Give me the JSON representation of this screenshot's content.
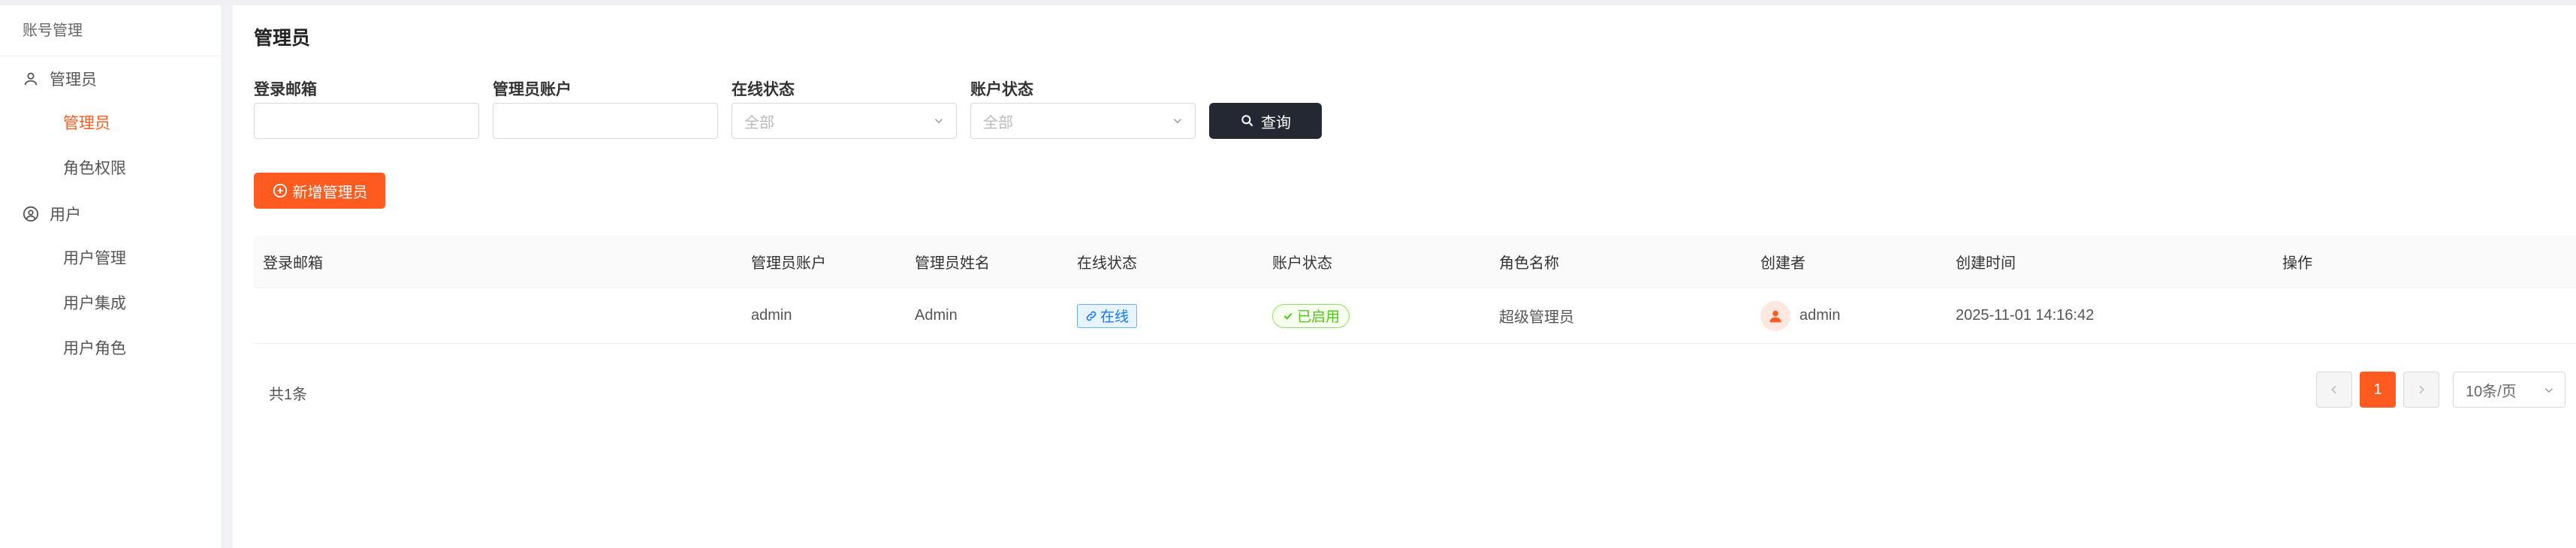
{
  "sidebar": {
    "title": "账号管理",
    "groups": [
      {
        "label": "管理员",
        "icon": "user-icon",
        "items": [
          {
            "label": "管理员",
            "active": true
          },
          {
            "label": "角色权限",
            "active": false
          }
        ]
      },
      {
        "label": "用户",
        "icon": "user-circle-icon",
        "items": [
          {
            "label": "用户管理",
            "active": false
          },
          {
            "label": "用户集成",
            "active": false
          },
          {
            "label": "用户角色",
            "active": false
          }
        ]
      }
    ]
  },
  "page": {
    "title": "管理员"
  },
  "filters": {
    "email": {
      "label": "登录邮箱",
      "value": ""
    },
    "account": {
      "label": "管理员账户",
      "value": ""
    },
    "online": {
      "label": "在线状态",
      "placeholder": "全部"
    },
    "status": {
      "label": "账户状态",
      "placeholder": "全部"
    },
    "search_label": "查询"
  },
  "actions": {
    "add_label": "新增管理员"
  },
  "table": {
    "columns": [
      "登录邮箱",
      "管理员账户",
      "管理员姓名",
      "在线状态",
      "账户状态",
      "角色名称",
      "创建者",
      "创建时间",
      "操作"
    ],
    "rows": [
      {
        "email": "",
        "account": "admin",
        "name": "Admin",
        "online": "在线",
        "status": "已启用",
        "role": "超级管理员",
        "creator": "admin",
        "created": "2025-11-01 14:16:42",
        "ops": ""
      }
    ]
  },
  "pagination": {
    "total": "共1条",
    "current": "1",
    "page_size": "10条/页"
  },
  "colors": {
    "accent": "#ff5a1f",
    "dark_button": "#232833",
    "online": "#1677ff",
    "enabled": "#52c41a"
  }
}
